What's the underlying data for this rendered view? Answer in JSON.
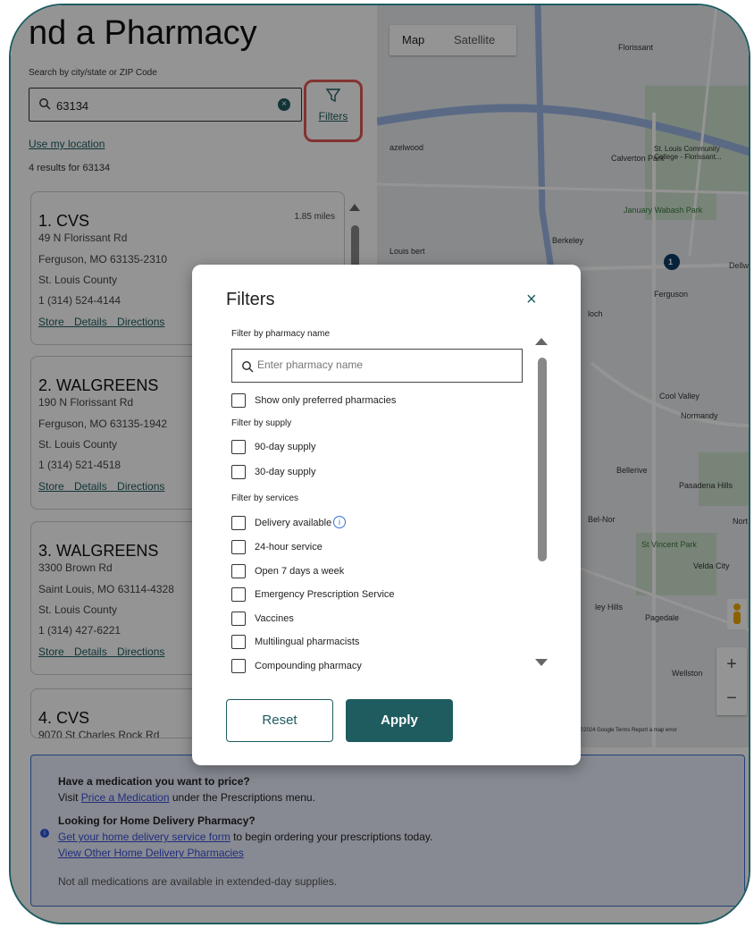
{
  "page": {
    "title": "nd a Pharmacy",
    "search_label": "Search by city/state or ZIP Code",
    "search_value": "63134",
    "filters_label": "Filters",
    "use_location": "Use my location",
    "results_text": "4 results for 63134"
  },
  "pharmacies": [
    {
      "name": "1. CVS",
      "distance": "1.85 miles",
      "address1": "49 N Florissant Rd",
      "address2": "Ferguson, MO 63135-2310",
      "county": "St. Louis County",
      "phone": "1 (314) 524-4144",
      "links": "Store Details Directions"
    },
    {
      "name": "2. WALGREENS",
      "address1": "190 N Florissant Rd",
      "address2": "Ferguson, MO 63135-1942",
      "county": "St. Louis County",
      "phone": "1 (314) 521-4518",
      "links": "Store Details Directions"
    },
    {
      "name": "3. WALGREENS",
      "address1": "3300 Brown Rd",
      "address2": "Saint Louis, MO 63114-4328",
      "county": "St. Louis County",
      "phone": "1 (314) 427-6221",
      "links": "Store Details Directions"
    },
    {
      "name": "4. CVS",
      "address1": "9070 St Charles Rock Rd"
    }
  ],
  "info": {
    "q1": "Have a medication you want to price?",
    "q1_pre": "Visit ",
    "q1_link": "Price a Medication",
    "q1_post": " under the Prescriptions menu.",
    "q2": "Looking for Home Delivery Pharmacy?",
    "q2_link": "Get your home delivery service form",
    "q2_post": " to begin ordering your prescriptions today.",
    "q2_link2": "View Other Home Delivery Pharmacies",
    "note": "Not all medications are available in extended-day supplies."
  },
  "map": {
    "tab_map": "Map",
    "tab_satellite": "Satellite",
    "labels": [
      "Florissant",
      "Calverton Park",
      "January Wabash Park",
      "Berkeley",
      "Ferguson",
      "Cool Valley",
      "Normandy",
      "Bellerive",
      "Pasadena Hills",
      "Bel-Nor",
      "St Vincent Park",
      "Velda City",
      "Pagedale",
      "Wellston",
      "azelwood",
      "St. Louis Community College - Florissant...",
      "Dellw",
      "Nort",
      "ley Hills",
      "Louis bert",
      "loch"
    ],
    "footer": "Map data ©2024 Google  Terms  Report a map error",
    "marker": "1"
  },
  "modal": {
    "title": "Filters",
    "close": "×",
    "sec_name": "Filter by pharmacy name",
    "name_placeholder": "Enter pharmacy name",
    "preferred": "Show only preferred pharmacies",
    "sec_supply": "Filter by supply",
    "supply": [
      "90-day supply",
      "30-day supply"
    ],
    "sec_services": "Filter by services",
    "services": [
      "Delivery available",
      "24-hour service",
      "Open 7 days a week",
      "Emergency Prescription Service",
      "Vaccines",
      "Multilingual pharmacists",
      "Compounding pharmacy"
    ],
    "info_icon": "i",
    "reset": "Reset",
    "apply": "Apply"
  },
  "colors": {
    "accent": "#1f5c60",
    "highlight": "#e05a55",
    "info_bg": "#e8eefc",
    "info_border": "#3a6fd0"
  }
}
